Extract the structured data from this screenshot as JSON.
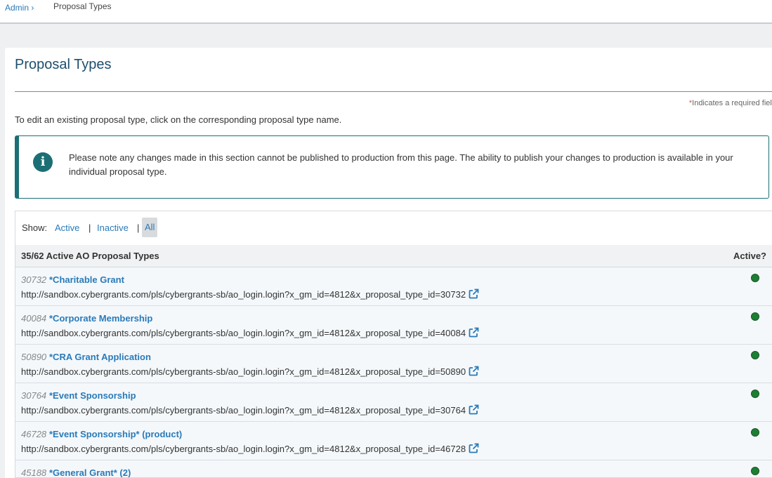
{
  "breadcrumb": {
    "admin": "Admin ›",
    "current": "Proposal Types"
  },
  "page": {
    "title": "Proposal Types",
    "required_star": "*",
    "required_note": "Indicates a required field",
    "instructions": "To edit an existing proposal type, click on the corresponding proposal type name.",
    "info": "Please note any changes made in this section cannot be published to production from this page. The ability to publish your changes to production is available in your individual proposal type."
  },
  "filter": {
    "label": "Show:",
    "active": "Active",
    "sep1": "|",
    "inactive": "Inactive",
    "sep2": "|",
    "all": "All"
  },
  "table": {
    "header_left": "35/62 Active AO Proposal Types",
    "header_right": "Active?",
    "rows": [
      {
        "id": "30732",
        "name": "*Charitable Grant",
        "url": "http://sandbox.cybergrants.com/pls/cybergrants-sb/ao_login.login?x_gm_id=4812&x_proposal_type_id=30732",
        "active": true
      },
      {
        "id": "40084",
        "name": "*Corporate Membership",
        "url": "http://sandbox.cybergrants.com/pls/cybergrants-sb/ao_login.login?x_gm_id=4812&x_proposal_type_id=40084",
        "active": true
      },
      {
        "id": "50890",
        "name": "*CRA Grant Application",
        "url": "http://sandbox.cybergrants.com/pls/cybergrants-sb/ao_login.login?x_gm_id=4812&x_proposal_type_id=50890",
        "active": true
      },
      {
        "id": "30764",
        "name": "*Event Sponsorship",
        "url": "http://sandbox.cybergrants.com/pls/cybergrants-sb/ao_login.login?x_gm_id=4812&x_proposal_type_id=30764",
        "active": true
      },
      {
        "id": "46728",
        "name": "*Event Sponsorship* (product)",
        "url": "http://sandbox.cybergrants.com/pls/cybergrants-sb/ao_login.login?x_gm_id=4812&x_proposal_type_id=46728",
        "active": true
      },
      {
        "id": "45188",
        "name": "*General Grant* (2)",
        "url": "",
        "active": true
      }
    ]
  },
  "colors": {
    "accent": "#1b6f74",
    "link": "#2a7ab8",
    "active_dot": "#1e7e34"
  },
  "icons": {
    "info": "info-circle-icon",
    "external": "external-link-icon",
    "status": "active-status-dot-icon"
  }
}
